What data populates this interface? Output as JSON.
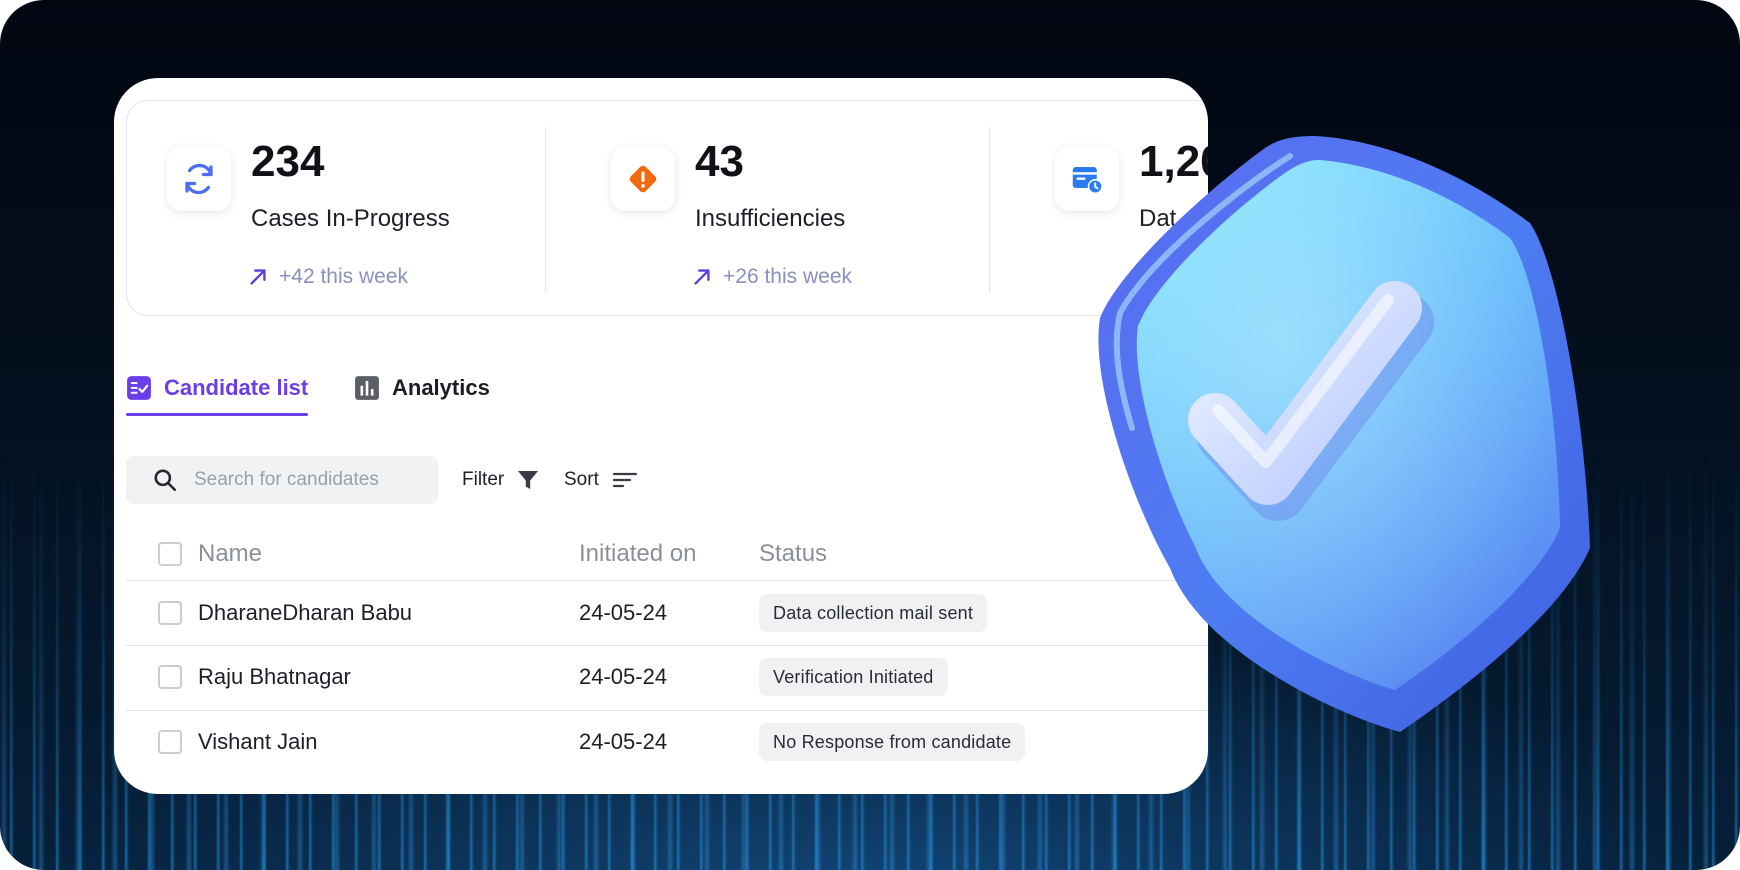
{
  "stats": [
    {
      "number": "234",
      "label": "Cases In-Progress",
      "trend": "+42 this week",
      "icon": "refresh-icon",
      "color": "#4d6cf0"
    },
    {
      "number": "43",
      "label": "Insufficiencies",
      "trend": "+26 this week",
      "icon": "warning-diamond-icon",
      "color": "#f06a0e"
    },
    {
      "number": "1,20",
      "label": "Dat",
      "icon": "calendar-clock-icon",
      "color": "#2b7cf0"
    }
  ],
  "tabs": [
    {
      "label": "Candidate list",
      "icon": "checklist-icon",
      "active": true
    },
    {
      "label": "Analytics",
      "icon": "bar-chart-icon",
      "active": false
    }
  ],
  "toolbar": {
    "search_placeholder": "Search for candidates",
    "filter_label": "Filter",
    "sort_label": "Sort"
  },
  "table": {
    "headers": {
      "name": "Name",
      "initiated": "Initiated on",
      "status": "Status"
    },
    "rows": [
      {
        "name": "DharaneDharan Babu",
        "initiated": "24-05-24",
        "status": "Data collection mail sent"
      },
      {
        "name": "Raju Bhatnagar",
        "initiated": "24-05-24",
        "status": "Verification Initiated"
      },
      {
        "name": "Vishant Jain",
        "initiated": "24-05-24",
        "status": "No Response from candidate"
      }
    ]
  },
  "colors": {
    "accent": "#6c3ee8",
    "trend": "#8a90bd",
    "shield": "#5a8cf5"
  },
  "decoration": {
    "icon": "shield-check-icon"
  }
}
